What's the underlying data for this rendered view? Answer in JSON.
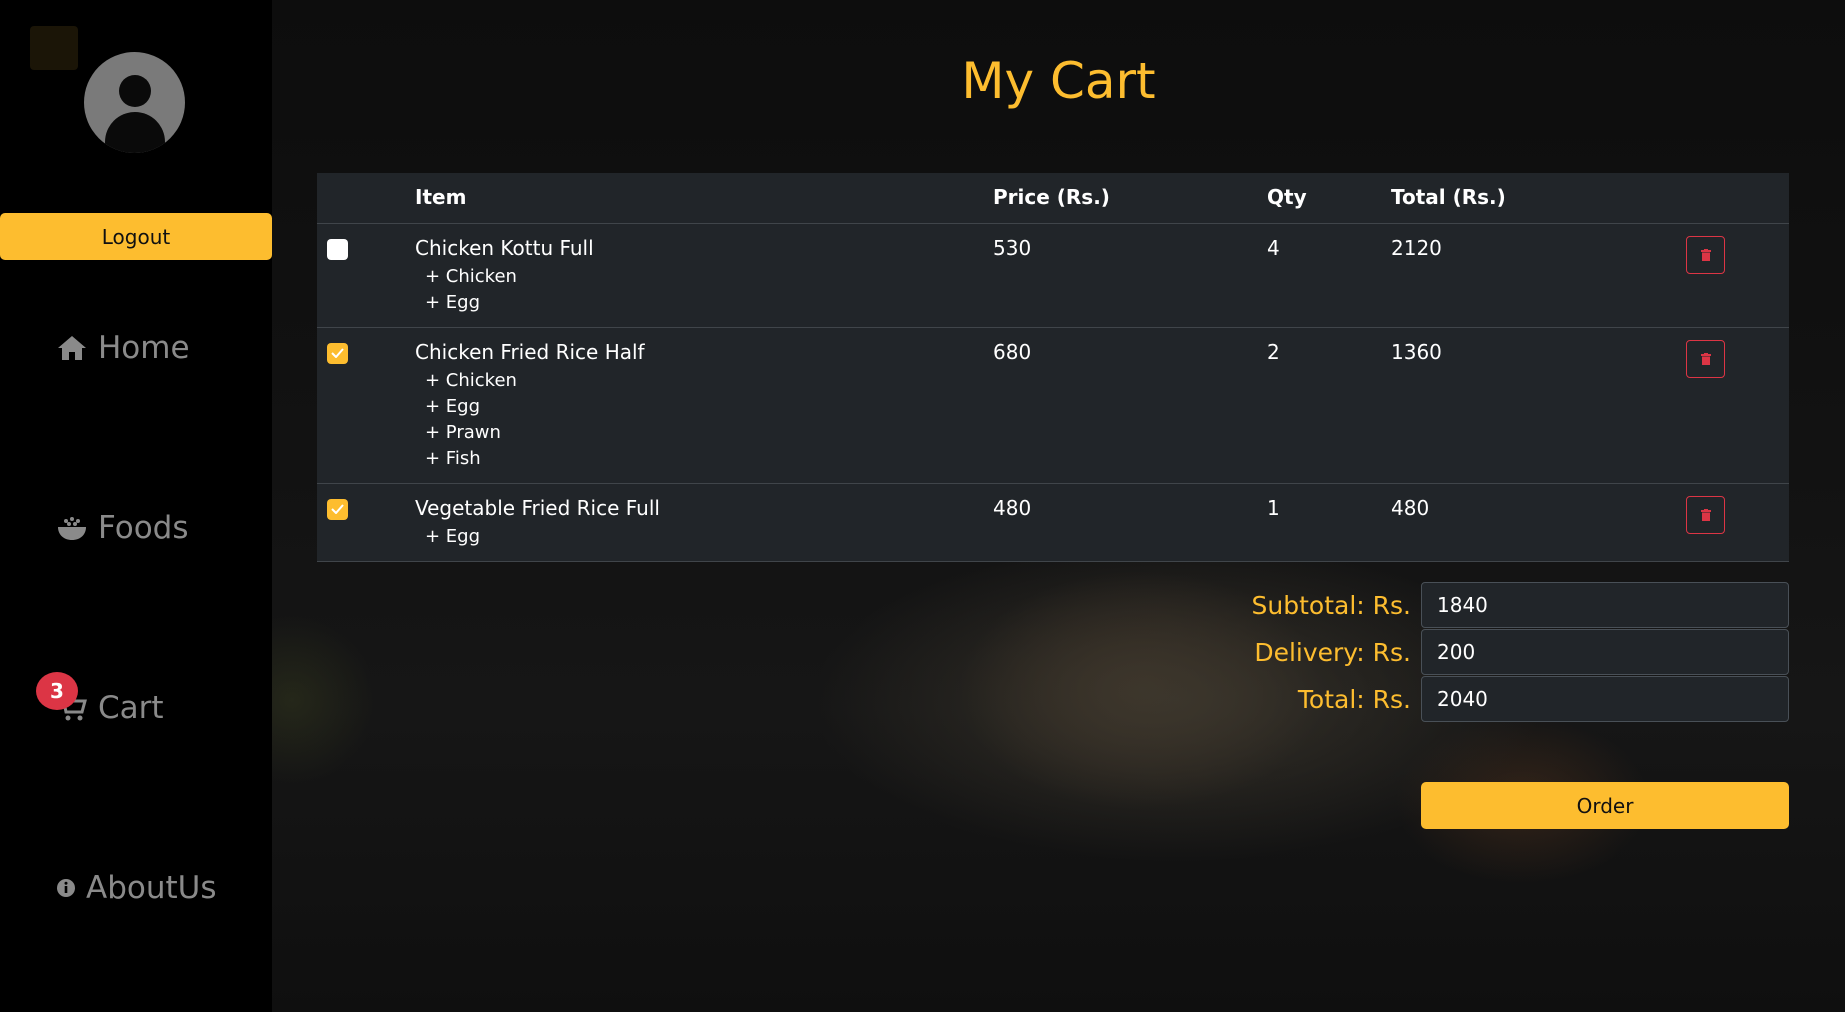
{
  "sidebar": {
    "logout_label": "Logout",
    "nav": [
      {
        "label": "Home",
        "icon": "home-icon"
      },
      {
        "label": "Foods",
        "icon": "rice-bowl-icon"
      },
      {
        "label": "Cart",
        "icon": "cart-icon"
      },
      {
        "label": "AboutUs",
        "icon": "info-icon"
      }
    ],
    "cart_count": "3"
  },
  "page_title": "My Cart",
  "table": {
    "headers": {
      "item": "Item",
      "price": "Price (Rs.)",
      "qty": "Qty",
      "total": "Total (Rs.)"
    },
    "rows": [
      {
        "checked": false,
        "name": "Chicken Kottu Full",
        "addons": [
          "+ Chicken",
          "+ Egg"
        ],
        "price": "530",
        "qty": "4",
        "total": "2120"
      },
      {
        "checked": true,
        "name": "Chicken Fried Rice Half",
        "addons": [
          "+ Chicken",
          "+ Egg",
          "+ Prawn",
          "+ Fish"
        ],
        "price": "680",
        "qty": "2",
        "total": "1360"
      },
      {
        "checked": true,
        "name": "Vegetable Fried Rice Full",
        "addons": [
          "+ Egg"
        ],
        "price": "480",
        "qty": "1",
        "total": "480"
      }
    ]
  },
  "summary": {
    "subtotal_label": "Subtotal: Rs.",
    "subtotal_value": "1840",
    "delivery_label": "Delivery: Rs.",
    "delivery_value": "200",
    "total_label": "Total: Rs.",
    "total_value": "2040"
  },
  "order_label": "Order",
  "colors": {
    "accent": "#fdbd2f",
    "danger": "#dc3545",
    "table_bg": "#212529"
  }
}
